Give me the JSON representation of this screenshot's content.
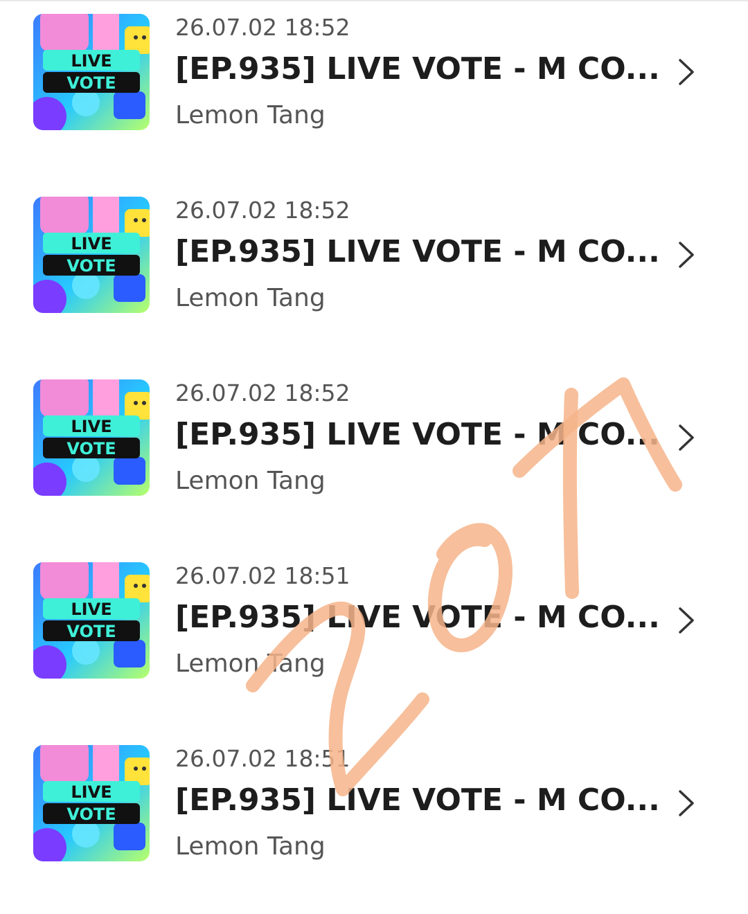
{
  "list": {
    "items": [
      {
        "timestamp": "26.07.02 18:52",
        "title": "[EP.935] LIVE VOTE - M CO...",
        "author": "Lemon Tang",
        "thumb_line1": "LIVE",
        "thumb_line2": "VOTE",
        "chevron_icon": "chevron-right-icon"
      },
      {
        "timestamp": "26.07.02 18:52",
        "title": "[EP.935] LIVE VOTE - M CO...",
        "author": "Lemon Tang",
        "thumb_line1": "LIVE",
        "thumb_line2": "VOTE",
        "chevron_icon": "chevron-right-icon"
      },
      {
        "timestamp": "26.07.02 18:52",
        "title": "[EP.935] LIVE VOTE - M CO...",
        "author": "Lemon Tang",
        "thumb_line1": "LIVE",
        "thumb_line2": "VOTE",
        "chevron_icon": "chevron-right-icon"
      },
      {
        "timestamp": "26.07.02 18:51",
        "title": "[EP.935] LIVE VOTE - M CO...",
        "author": "Lemon Tang",
        "thumb_line1": "LIVE",
        "thumb_line2": "VOTE",
        "chevron_icon": "chevron-right-icon"
      },
      {
        "timestamp": "26.07.02 18:51",
        "title": "[EP.935] LIVE VOTE - M CO...",
        "author": "Lemon Tang",
        "thumb_line1": "LIVE",
        "thumb_line2": "VOTE",
        "chevron_icon": "chevron-right-icon"
      }
    ]
  },
  "annotation": {
    "handwriting": "20↑",
    "color": "#f6b48a"
  },
  "colors": {
    "text_primary": "#1d1d1d",
    "text_secondary": "#555555",
    "chevron": "#333333"
  }
}
